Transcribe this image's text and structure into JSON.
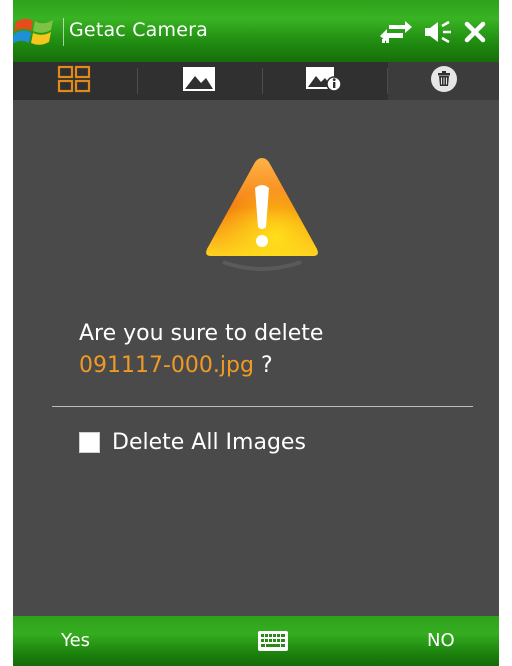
{
  "titlebar": {
    "app_title": "Getac Camera",
    "icons": [
      "windows-start-flag-icon",
      "connectivity-arrows-icon",
      "speaker-icon",
      "close-icon"
    ]
  },
  "tabs": [
    {
      "icon": "thumbnail-grid-icon",
      "active": false
    },
    {
      "icon": "image-view-icon",
      "active": false
    },
    {
      "icon": "image-info-icon",
      "active": false
    },
    {
      "icon": "trash-icon",
      "active": true
    }
  ],
  "dialog": {
    "icon": "warning-icon",
    "question": "Are you sure to delete",
    "filename": "091117-000.jpg",
    "question_end": " ?",
    "checkbox_label": "Delete All Images",
    "checkbox_checked": false
  },
  "softkeys": {
    "left": "Yes",
    "right": "NO",
    "center_icon": "keyboard-icon"
  },
  "colors": {
    "accent_orange": "#f09a26",
    "titlebar_green": "#2fa21b",
    "background": "#4a4a4a"
  }
}
